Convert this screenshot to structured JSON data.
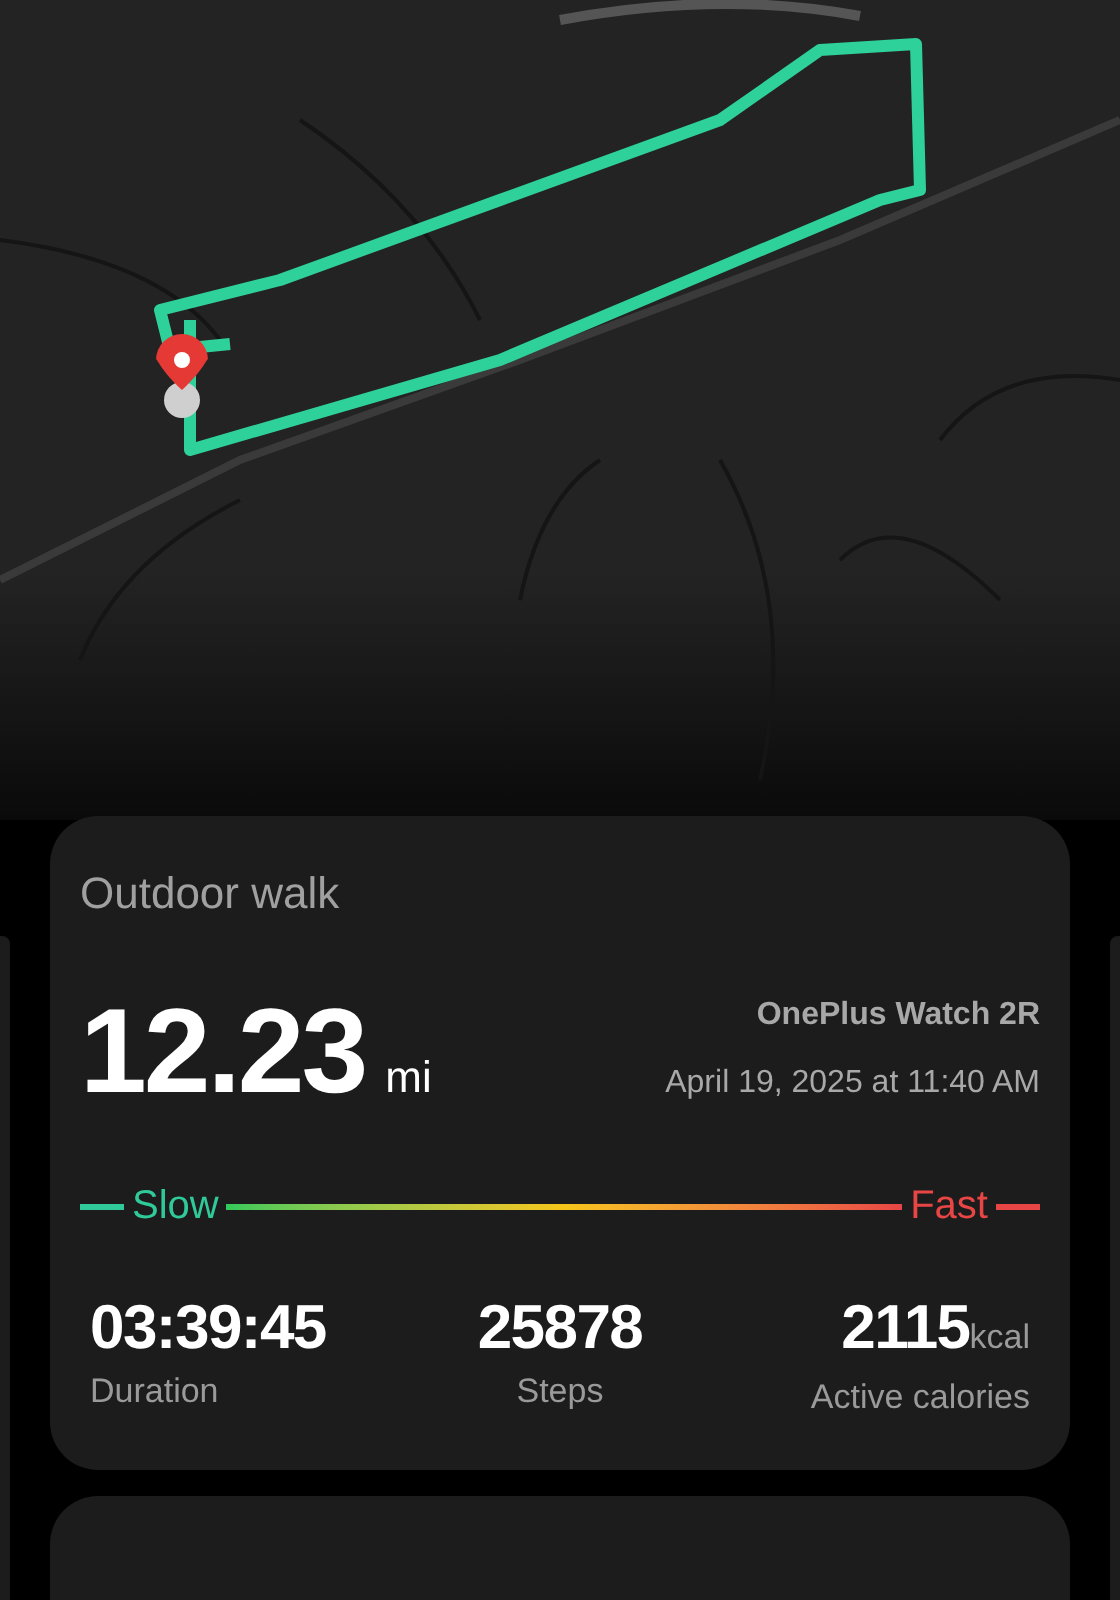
{
  "workout": {
    "title": "Outdoor walk",
    "distance": "12.23",
    "distance_unit": "mi",
    "device": "OnePlus Watch 2R",
    "date": "April 19, 2025 at 11:40 AM"
  },
  "pace_legend": {
    "slow": "Slow",
    "fast": "Fast"
  },
  "stats": [
    {
      "value": "03:39:45",
      "label": "Duration"
    },
    {
      "value": "25878",
      "label": "Steps"
    },
    {
      "value": "2115",
      "unit": "kcal",
      "label": "Active calories"
    }
  ]
}
